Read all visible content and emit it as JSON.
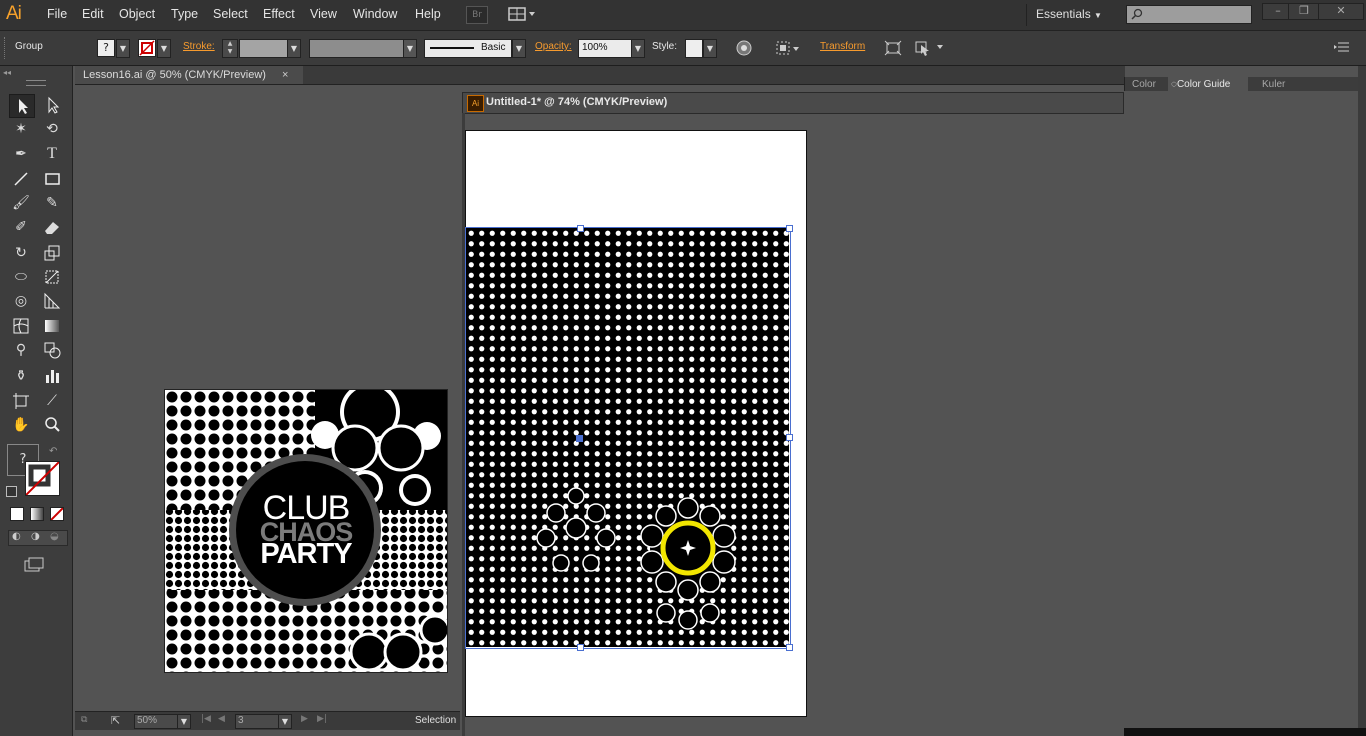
{
  "app": {
    "logo": "Ai"
  },
  "menu": [
    "File",
    "Edit",
    "Object",
    "Type",
    "Select",
    "Effect",
    "View",
    "Window",
    "Help"
  ],
  "bridge_label": "Br",
  "workspace": "Essentials",
  "control": {
    "selection_type": "Group",
    "stroke_label": "Stroke:",
    "stroke_style": "Basic",
    "opacity_label": "Opacity:",
    "opacity_value": "100%",
    "style_label": "Style:",
    "transform_label": "Transform"
  },
  "docs": {
    "tab1": "Lesson16.ai @ 50% (CMYK/Preview)",
    "tab1_close": "×",
    "tab2": "Untitled-1* @ 74% (CMYK/Preview)"
  },
  "panels": {
    "tabs": [
      "Color",
      "Color Guide",
      "Kuler"
    ],
    "active": "Color Guide"
  },
  "poster": {
    "line1": "CLUB",
    "line2": "CHAOS",
    "line3": "PARTY"
  },
  "status": {
    "zoom": "50%",
    "page": "3",
    "tool": "Selection"
  },
  "toolbox": {
    "fill_stroke_unknown": "?"
  },
  "colors": {
    "accent": "#f7a12b",
    "highlight": "#f2e600",
    "selection": "#4a6fd0"
  }
}
